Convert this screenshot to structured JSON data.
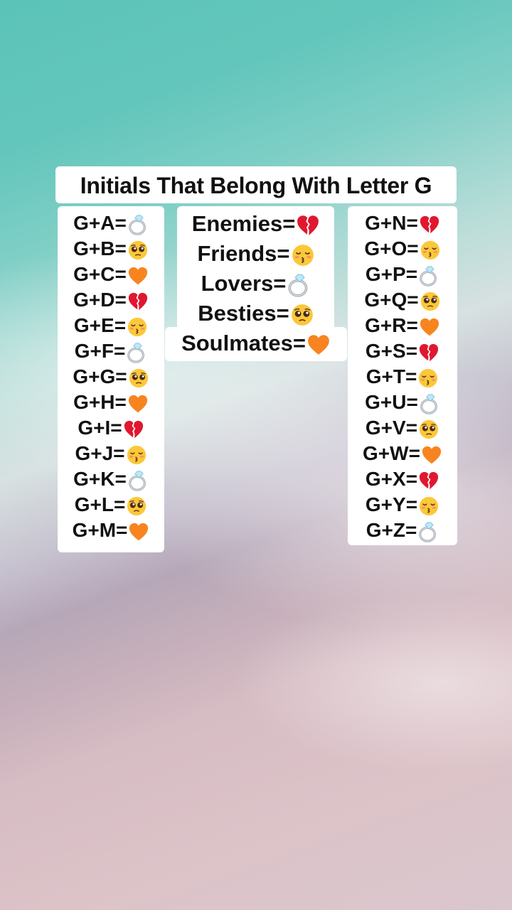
{
  "title": "Initials That Belong With Letter G",
  "left_column": [
    {
      "text": "G+A=",
      "emoji": "ring-icon"
    },
    {
      "text": "G+B=",
      "emoji": "pleading-face-icon"
    },
    {
      "text": "G+C=",
      "emoji": "orange-heart-icon"
    },
    {
      "text": "G+D=",
      "emoji": "broken-heart-icon"
    },
    {
      "text": "G+E=",
      "emoji": "kissing-face-icon"
    },
    {
      "text": "G+F=",
      "emoji": "ring-icon"
    },
    {
      "text": "G+G=",
      "emoji": "pleading-face-icon"
    },
    {
      "text": "G+H=",
      "emoji": "orange-heart-icon"
    },
    {
      "text": "G+I=",
      "emoji": "broken-heart-icon"
    },
    {
      "text": "G+J=",
      "emoji": "kissing-face-icon"
    },
    {
      "text": "G+K=",
      "emoji": "ring-icon"
    },
    {
      "text": "G+L=",
      "emoji": "pleading-face-icon"
    },
    {
      "text": "G+M=",
      "emoji": "orange-heart-icon"
    }
  ],
  "legend": [
    {
      "text": "Enemies=",
      "emoji": "broken-heart-icon"
    },
    {
      "text": "Friends=",
      "emoji": "kissing-face-icon"
    },
    {
      "text": "Lovers=",
      "emoji": "ring-icon"
    },
    {
      "text": "Besties=",
      "emoji": "pleading-face-icon"
    },
    {
      "text": "Soulmates=",
      "emoji": "orange-heart-icon"
    }
  ],
  "right_column": [
    {
      "text": "G+N=",
      "emoji": "broken-heart-icon"
    },
    {
      "text": "G+O=",
      "emoji": "kissing-face-icon"
    },
    {
      "text": "G+P=",
      "emoji": "ring-icon"
    },
    {
      "text": "G+Q=",
      "emoji": "pleading-face-icon"
    },
    {
      "text": "G+R=",
      "emoji": "orange-heart-icon"
    },
    {
      "text": "G+S=",
      "emoji": "broken-heart-icon"
    },
    {
      "text": "G+T=",
      "emoji": "kissing-face-icon"
    },
    {
      "text": "G+U=",
      "emoji": "ring-icon"
    },
    {
      "text": "G+V=",
      "emoji": "pleading-face-icon"
    },
    {
      "text": "G+W=",
      "emoji": "orange-heart-icon"
    },
    {
      "text": "G+X=",
      "emoji": "broken-heart-icon"
    },
    {
      "text": "G+Y=",
      "emoji": "kissing-face-icon"
    },
    {
      "text": "G+Z=",
      "emoji": "ring-icon"
    }
  ],
  "colors": {
    "sea": "#5cc3b8",
    "sand": "#d9c1c6",
    "text": "#111111",
    "box": "#ffffff",
    "heart_orange": "#f7841f",
    "heart_red": "#e0182f",
    "face_yellow": "#fbc83a"
  }
}
